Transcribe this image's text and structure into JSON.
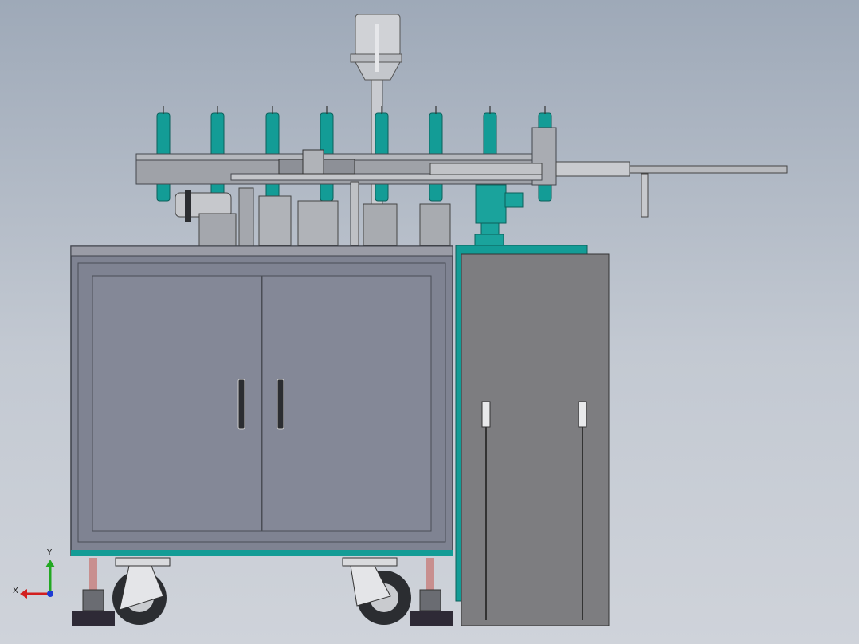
{
  "viewport": {
    "background_top": "#9ea9b8",
    "background_bottom": "#cfd3da"
  },
  "model": {
    "description_colors": {
      "cabinet": "#7f8392",
      "cabinet_edge": "#4a4d55",
      "accent_teal": "#139c96",
      "steel": "#c9cbd0",
      "dark": "#2f3137",
      "side_panel": "#7d7d80"
    }
  },
  "triad": {
    "x_label": "X",
    "y_label": "Y",
    "x_color": "#d21f1f",
    "y_color": "#22a822",
    "z_color": "#1d3bd4"
  }
}
